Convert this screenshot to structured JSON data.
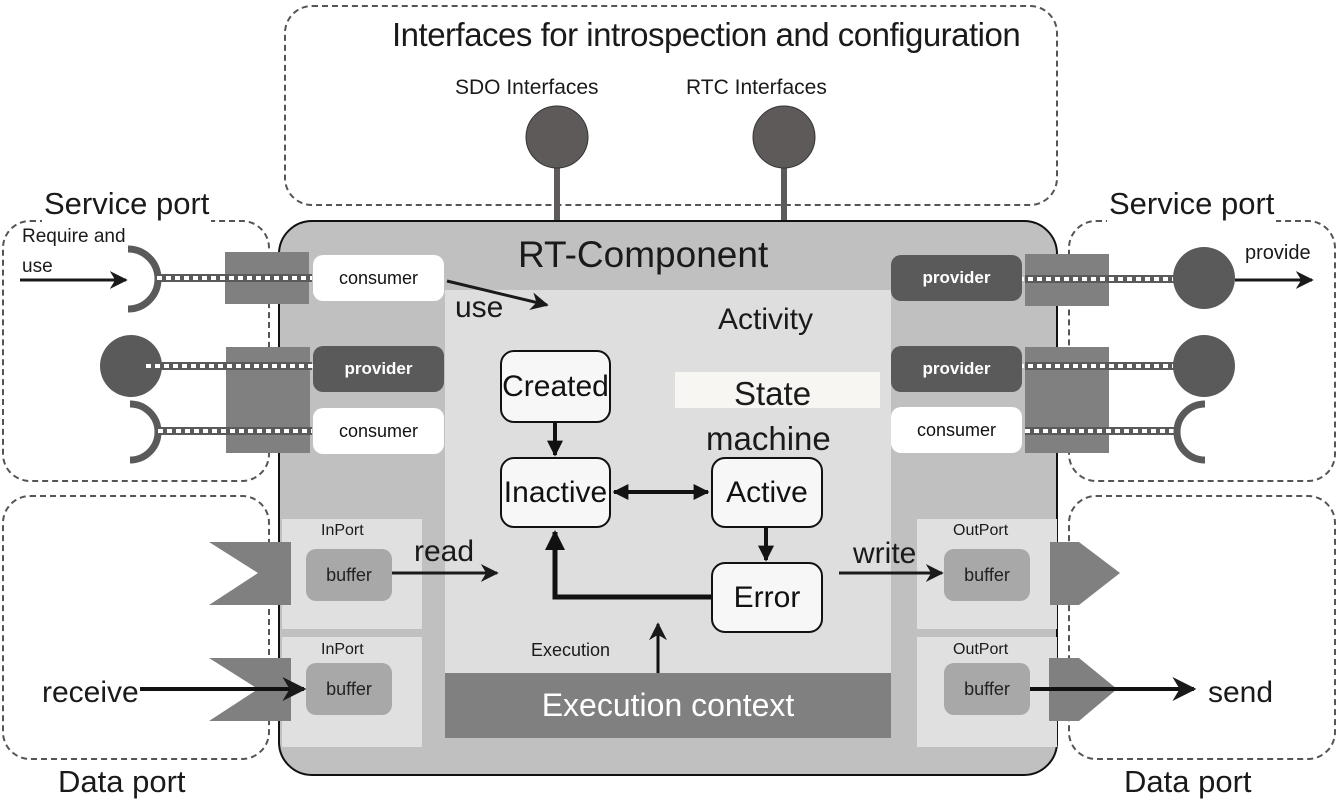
{
  "top_panel": {
    "title": "Interfaces for introspection and configuration",
    "interfaces": [
      {
        "label": "SDO Interfaces"
      },
      {
        "label": "RTC Interfaces"
      }
    ]
  },
  "left_service_port": {
    "title": "Service port",
    "annotation": "Require and use",
    "annotation_line1": "Require and",
    "annotation_line2": "use",
    "ports": [
      {
        "role": "consumer",
        "connector": "socket"
      },
      {
        "role": "provider",
        "connector": "lollipop"
      },
      {
        "role": "consumer",
        "connector": "socket"
      }
    ]
  },
  "right_service_port": {
    "title": "Service port",
    "annotation": "provide",
    "ports": [
      {
        "role": "provider",
        "connector": "lollipop"
      },
      {
        "role": "provider",
        "connector": "lollipop"
      },
      {
        "role": "consumer",
        "connector": "socket"
      }
    ]
  },
  "component": {
    "title": "RT-Component",
    "use_label": "use",
    "activity_label": "Activity",
    "state_machine_line1": "State",
    "state_machine_line2": "machine",
    "states": [
      "Created",
      "Inactive",
      "Active",
      "Error"
    ],
    "transitions": [
      {
        "from": "Created",
        "to": "Inactive"
      },
      {
        "from": "Inactive",
        "to": "Active",
        "bidirectional": true
      },
      {
        "from": "Active",
        "to": "Error"
      },
      {
        "from": "Error",
        "to": "Inactive"
      }
    ],
    "execution_label": "Execution",
    "execution_context_label": "Execution context",
    "read_label": "read",
    "write_label": "write"
  },
  "left_data_port": {
    "title": "Data port",
    "annotation": "receive",
    "inports": [
      {
        "label": "InPort",
        "buffer": "buffer"
      },
      {
        "label": "InPort",
        "buffer": "buffer"
      }
    ]
  },
  "right_data_port": {
    "title": "Data port",
    "annotation": "send",
    "outports": [
      {
        "label": "OutPort",
        "buffer": "buffer"
      },
      {
        "label": "OutPort",
        "buffer": "buffer"
      }
    ]
  },
  "colors": {
    "component_fill": "#c0c0c0",
    "activity_fill": "#dedede",
    "port_square": "#808080",
    "provider_fill": "#5a5a5a",
    "interface_ball": "#5e5a5a",
    "buffer_fill": "#a8a8a8"
  }
}
